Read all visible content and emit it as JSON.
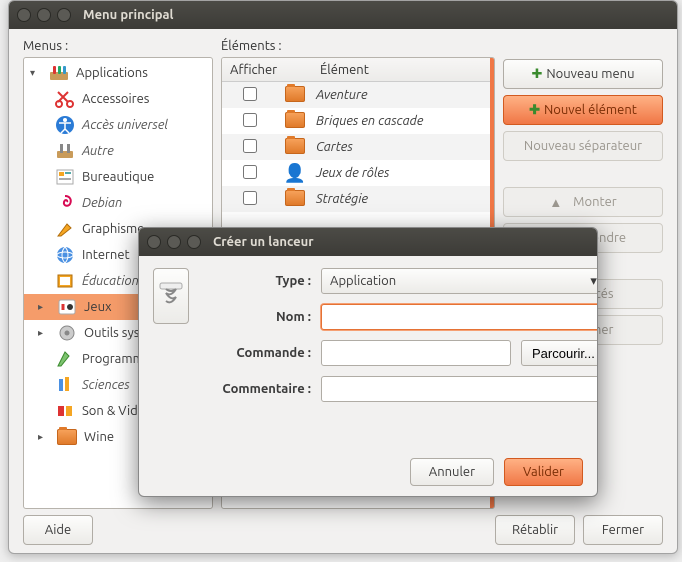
{
  "main_window": {
    "title": "Menu principal",
    "menus_label": "Menus :",
    "elements_label": "Éléments :",
    "col_show": "Afficher",
    "col_item": "Élément"
  },
  "tree": {
    "root": "Applications",
    "items": [
      {
        "label": "Accessoires",
        "italic": false
      },
      {
        "label": "Accès universel",
        "italic": true
      },
      {
        "label": "Autre",
        "italic": true
      },
      {
        "label": "Bureautique",
        "italic": false
      },
      {
        "label": "Debian",
        "italic": true
      },
      {
        "label": "Graphisme",
        "italic": false
      },
      {
        "label": "Internet",
        "italic": false
      },
      {
        "label": "Éducation",
        "italic": true
      },
      {
        "label": "Jeux",
        "italic": false,
        "selected": true,
        "arrow": true
      },
      {
        "label": "Outils système",
        "italic": false,
        "arrow": true
      },
      {
        "label": "Programmation",
        "italic": false
      },
      {
        "label": "Sciences",
        "italic": true
      },
      {
        "label": "Son & Vidéo",
        "italic": false
      },
      {
        "label": "Wine",
        "italic": false,
        "arrow": true
      }
    ]
  },
  "table": {
    "rows": [
      {
        "label": "Aventure",
        "folder": true
      },
      {
        "label": "Briques en cascade",
        "folder": true
      },
      {
        "label": "Cartes",
        "folder": true
      },
      {
        "label": "Jeux de rôles",
        "folder": false
      },
      {
        "label": "Stratégie",
        "folder": true
      }
    ]
  },
  "buttons": {
    "new_menu": "Nouveau menu",
    "new_item": "Nouvel élément",
    "new_sep": "Nouveau séparateur",
    "up": "Monter",
    "down": "Descendre",
    "props": "Propriétés",
    "delete": "Supprimer",
    "help": "Aide",
    "restore": "Rétablir",
    "close": "Fermer"
  },
  "dialog": {
    "title": "Créer un lanceur",
    "type_lbl": "Type :",
    "type_val": "Application",
    "name_lbl": "Nom :",
    "name_val": "",
    "cmd_lbl": "Commande :",
    "cmd_val": "",
    "browse": "Parcourir...",
    "comment_lbl": "Commentaire :",
    "comment_val": "",
    "cancel": "Annuler",
    "ok": "Valider"
  }
}
